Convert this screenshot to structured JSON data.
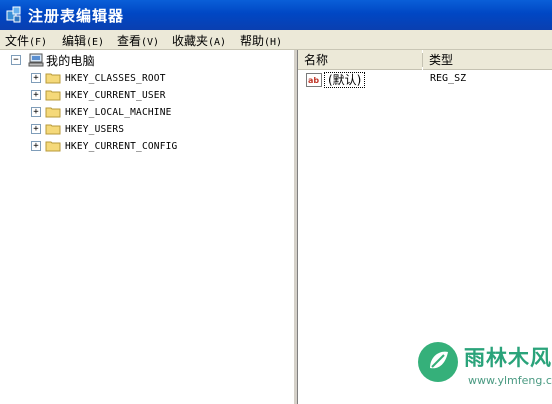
{
  "window": {
    "title": "注册表编辑器"
  },
  "menu": [
    {
      "label": "文件",
      "mnemonic": "(F)"
    },
    {
      "label": "编辑",
      "mnemonic": "(E)"
    },
    {
      "label": "查看",
      "mnemonic": "(V)"
    },
    {
      "label": "收藏夹",
      "mnemonic": "(A)"
    },
    {
      "label": "帮助",
      "mnemonic": "(H)"
    }
  ],
  "tree": {
    "root": "我的电脑",
    "nodes": [
      {
        "label": "HKEY_CLASSES_ROOT",
        "expander": "+"
      },
      {
        "label": "HKEY_CURRENT_USER",
        "expander": "+"
      },
      {
        "label": "HKEY_LOCAL_MACHINE",
        "expander": "+"
      },
      {
        "label": "HKEY_USERS",
        "expander": "+"
      },
      {
        "label": "HKEY_CURRENT_CONFIG",
        "expander": "+"
      }
    ]
  },
  "list": {
    "columns": {
      "name": "名称",
      "type": "类型"
    },
    "rows": [
      {
        "name": "(默认)",
        "type": "REG_SZ"
      }
    ]
  },
  "watermark": {
    "name": "雨林木风",
    "url": "www.ylmfeng.com"
  },
  "icons": {
    "app": "registry-editor-icon",
    "computer": "computer-icon",
    "folder": "folder-icon",
    "value": "string-value-icon"
  }
}
